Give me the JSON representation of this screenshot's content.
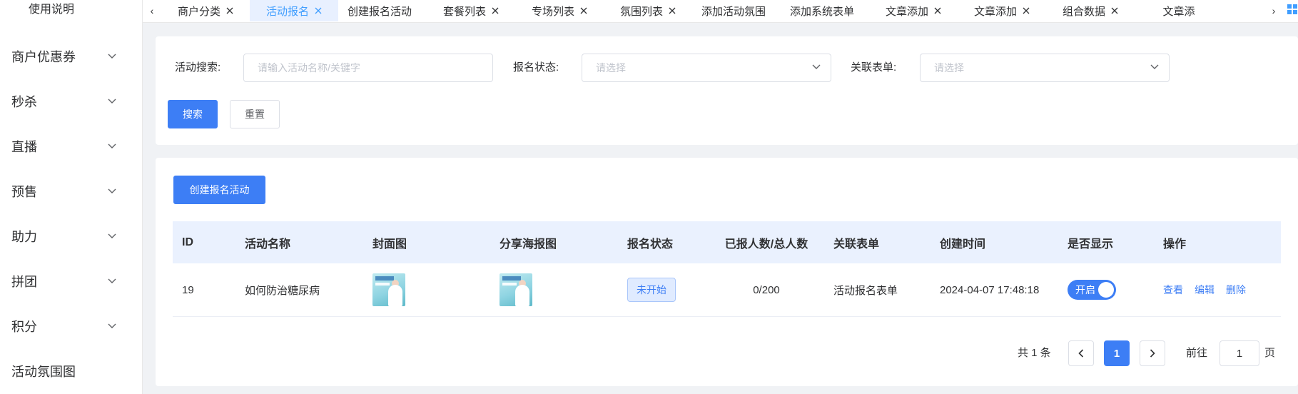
{
  "sidebar": {
    "top_label": "使用说明",
    "items": [
      {
        "label": "商户优惠券",
        "has_chevron": true
      },
      {
        "label": "秒杀",
        "has_chevron": true
      },
      {
        "label": "直播",
        "has_chevron": true
      },
      {
        "label": "预售",
        "has_chevron": true
      },
      {
        "label": "助力",
        "has_chevron": true
      },
      {
        "label": "拼团",
        "has_chevron": true
      },
      {
        "label": "积分",
        "has_chevron": true
      },
      {
        "label": "活动氛围图",
        "has_chevron": false
      }
    ]
  },
  "tabs": {
    "items": [
      {
        "label": "商户分类",
        "active": false
      },
      {
        "label": "活动报名",
        "active": true
      },
      {
        "label": "创建报名活动",
        "active": false
      },
      {
        "label": "套餐列表",
        "active": false
      },
      {
        "label": "专场列表",
        "active": false
      },
      {
        "label": "氛围列表",
        "active": false
      },
      {
        "label": "添加活动氛围",
        "active": false
      },
      {
        "label": "添加系统表单",
        "active": false
      },
      {
        "label": "文章添加",
        "active": false
      },
      {
        "label": "文章添加",
        "active": false
      },
      {
        "label": "组合数据",
        "active": false
      },
      {
        "label": "文章添",
        "active": false
      }
    ],
    "left_arrow": "‹",
    "right_arrow": "›"
  },
  "search": {
    "activity_label": "活动搜索:",
    "activity_placeholder": "请输入活动名称/关键字",
    "status_label": "报名状态:",
    "status_placeholder": "请选择",
    "form_label": "关联表单:",
    "form_placeholder": "请选择",
    "search_button": "搜索",
    "reset_button": "重置"
  },
  "table": {
    "create_button": "创建报名活动",
    "columns": [
      "ID",
      "活动名称",
      "封面图",
      "分享海报图",
      "报名状态",
      "已报人数/总人数",
      "关联表单",
      "创建时间",
      "是否显示",
      "操作"
    ],
    "rows": [
      {
        "id": "19",
        "name": "如何防治糖尿病",
        "status": "未开始",
        "count": "0/200",
        "form": "活动报名表单",
        "created": "2024-04-07 17:48:18",
        "show": "开启",
        "actions": [
          "查看",
          "编辑",
          "删除"
        ]
      }
    ]
  },
  "pagination": {
    "total": "共 1 条",
    "current_page": "1",
    "goto_label": "前往",
    "goto_value": "1",
    "page_unit": "页"
  },
  "colors": {
    "primary": "#3d7ef5",
    "active_tab_bg": "#e8f0ff",
    "header_bg": "#eaf1fe"
  }
}
